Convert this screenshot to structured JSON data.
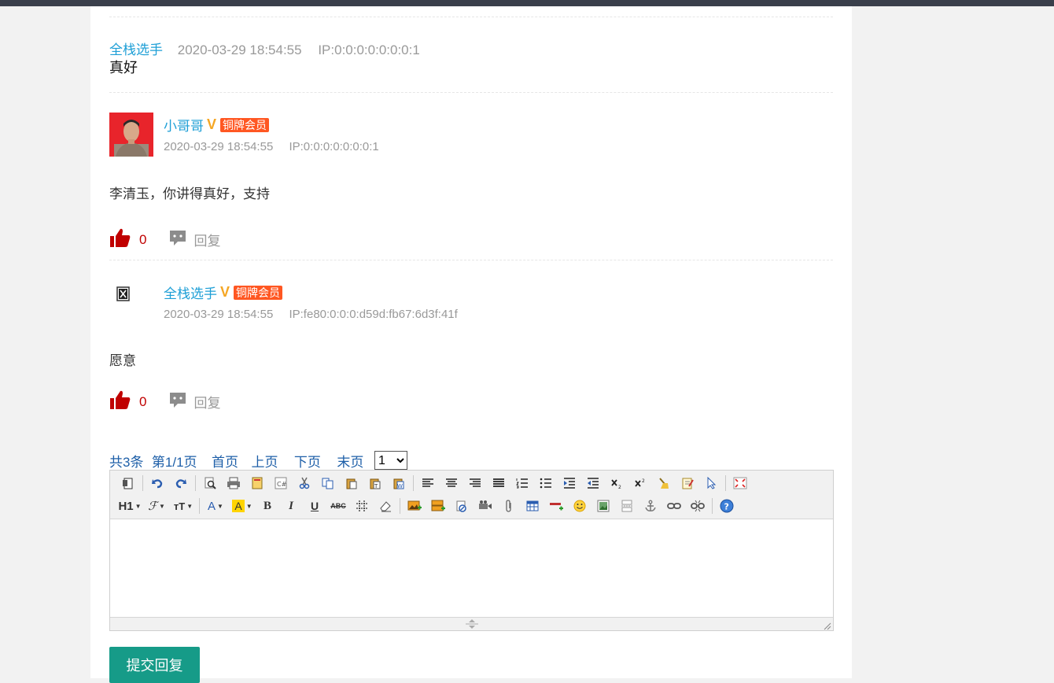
{
  "comments": [
    {
      "author": "全栈选手",
      "time": "2020-03-29 18:54:55",
      "ip": "IP:0:0:0:0:0:0:0:1",
      "text": "真好"
    },
    {
      "author": "小哥哥",
      "level": "铜牌会员",
      "verified_mark": "V",
      "time": "2020-03-29 18:54:55",
      "ip": "IP:0:0:0:0:0:0:0:1",
      "text": "李清玉，你讲得真好，支持",
      "likes": "0",
      "reply_label": "回复"
    },
    {
      "author": "全栈选手",
      "level": "铜牌会员",
      "verified_mark": "V",
      "time": "2020-03-29 18:54:55",
      "ip": "IP:fe80:0:0:0:d59d:fb67:6d3f:41f",
      "text": "愿意",
      "likes": "0",
      "reply_label": "回复"
    }
  ],
  "pager": {
    "total": "共3条",
    "page": "第1/1页",
    "first": "首页",
    "prev": "上页",
    "next": "下页",
    "last": "末页",
    "selected": "1"
  },
  "editor": {
    "heading_button": "H1",
    "bold": "B",
    "italic": "I",
    "underline": "U",
    "strike": "ABC"
  },
  "submit_label": "提交回复",
  "colors": {
    "link": "#1e9fd6",
    "badge": "#ff5722",
    "like": "#c00000",
    "submit": "#169b88"
  }
}
